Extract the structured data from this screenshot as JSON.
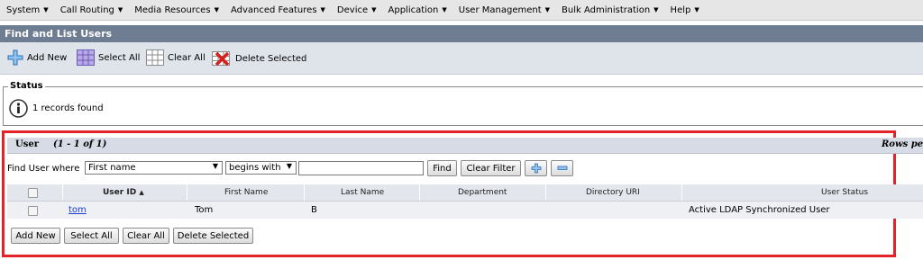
{
  "menu": [
    {
      "label": "System"
    },
    {
      "label": "Call Routing"
    },
    {
      "label": "Media Resources"
    },
    {
      "label": "Advanced Features"
    },
    {
      "label": "Device"
    },
    {
      "label": "Application"
    },
    {
      "label": "User Management"
    },
    {
      "label": "Bulk Administration"
    },
    {
      "label": "Help"
    }
  ],
  "page_title": "Find and List Users",
  "toolbar": {
    "add_new": "Add New",
    "select_all": "Select All",
    "clear_all": "Clear All",
    "delete_selected": "Delete Selected"
  },
  "status": {
    "legend": "Status",
    "message": "1 records found"
  },
  "section": {
    "title": "User",
    "range": "(1 - 1 of 1)",
    "rows_per": "Rows per Page"
  },
  "filter": {
    "label": "Find User where",
    "field": "First name",
    "operator": "begins with",
    "value": "",
    "find_button": "Find",
    "clear_filter_button": "Clear Filter"
  },
  "table": {
    "headers": [
      "User ID",
      "First Name",
      "Last Name",
      "Department",
      "Directory URI",
      "User Status"
    ],
    "sort_indicator": "▲",
    "rows": [
      {
        "user_id": "tom",
        "first_name": "Tom",
        "last_name": "B",
        "department": "",
        "directory_uri": "",
        "user_status": "Active LDAP Synchronized User"
      }
    ]
  },
  "bottom_buttons": {
    "add_new": "Add New",
    "select_all": "Select All",
    "clear_all": "Clear All",
    "delete_selected": "Delete Selected"
  }
}
